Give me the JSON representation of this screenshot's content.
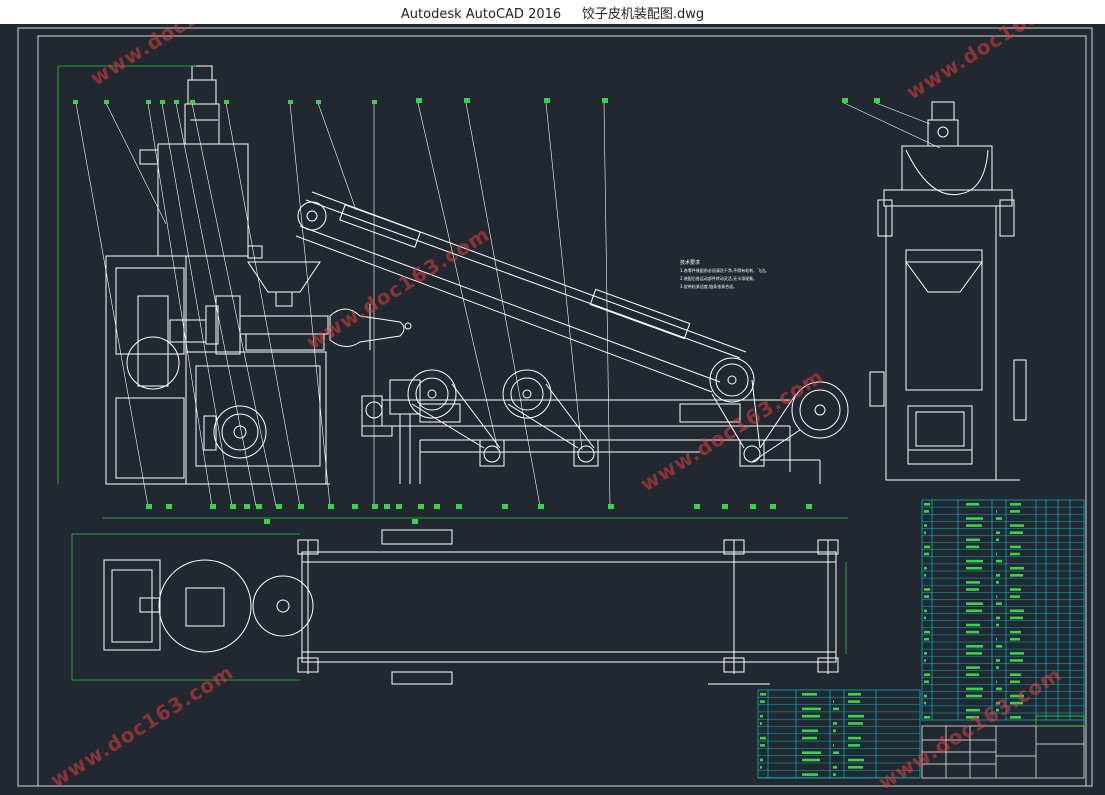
{
  "window": {
    "title": "Autodesk AutoCAD 2016     饺子皮机装配图.dwg"
  },
  "watermark": {
    "text": "www.doc163.com"
  },
  "colors": {
    "background": "#212830",
    "linework": "#ffffff",
    "balloons": "#3fd14a",
    "table_grid": "#00d5e8",
    "table_text": "#3fd14a",
    "watermark": "#e04040"
  },
  "drawing": {
    "tech_notes": [
      "技术要求",
      "1.各零件装配前必须清洗干净,不得有毛刺、飞边。",
      "2.装配后各运动部件转动灵活,无卡滞现象。",
      "3.皮带松紧适度,链条张紧合适。"
    ]
  }
}
